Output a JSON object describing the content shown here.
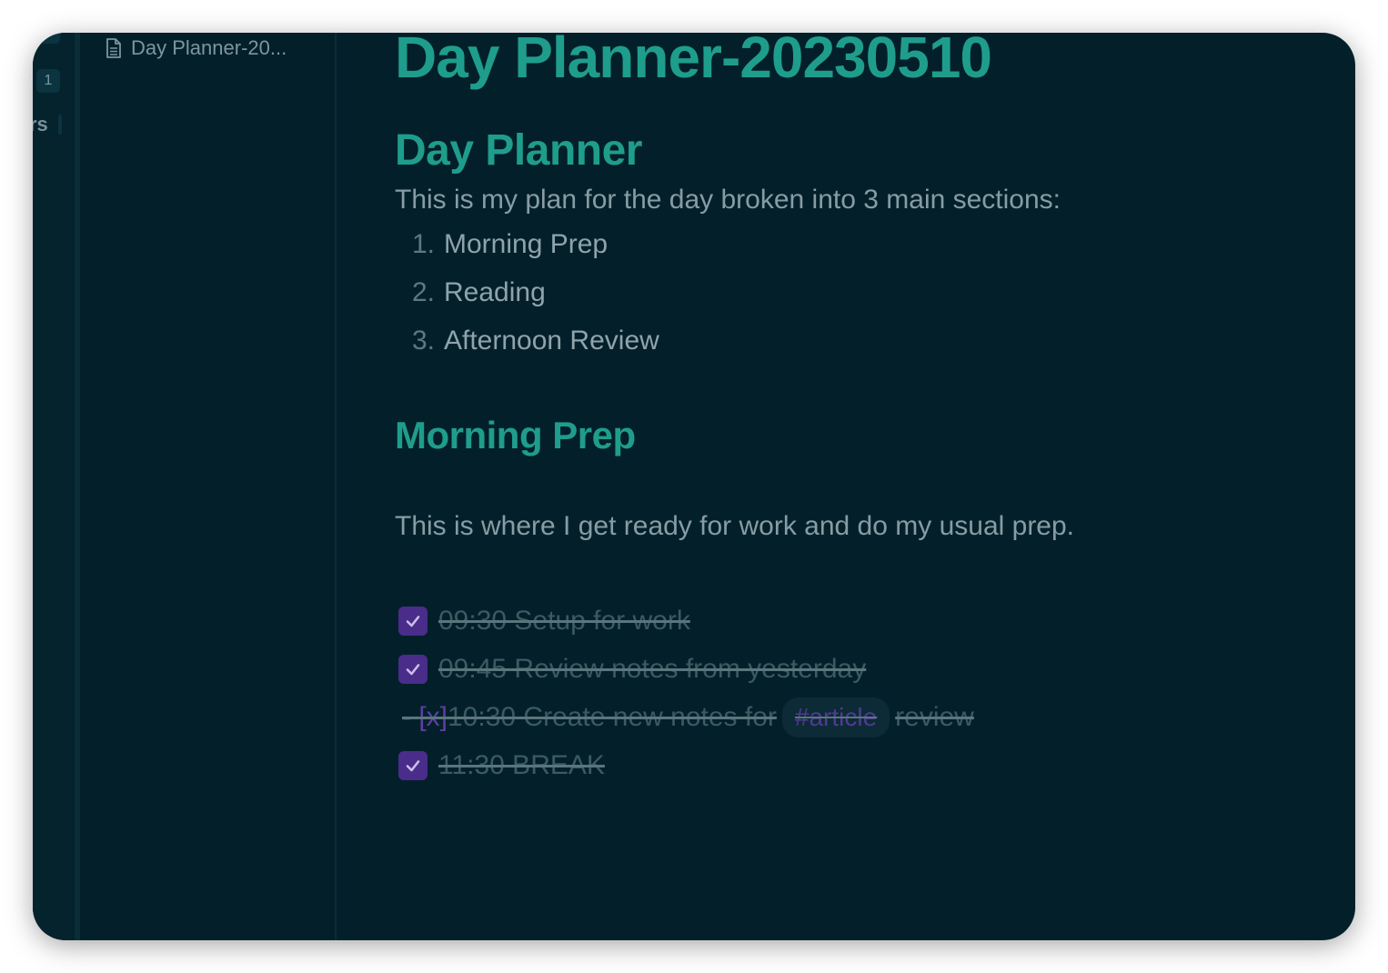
{
  "ribbon": {
    "badge_count": "1",
    "clip_text": "–",
    "partial_label": "rs"
  },
  "explorer": {
    "file_name": "Day Planner-20..."
  },
  "editor": {
    "title": "Day Planner-20230510",
    "section1_heading": "Day Planner",
    "section1_intro": "This is my plan for the day broken into 3 main sections:",
    "list": [
      {
        "num": "1.",
        "text": "Morning Prep"
      },
      {
        "num": "2.",
        "text": "Reading"
      },
      {
        "num": "3.",
        "text": "Afternoon Review"
      }
    ],
    "section2_heading": "Morning Prep",
    "section2_text": "This is where I get ready for work and do my usual prep.",
    "tasks": [
      {
        "text": "09:30 Setup for work",
        "checked": true
      },
      {
        "text": "09:45 Review notes from yesterday",
        "checked": true
      }
    ],
    "raw_task": {
      "dash": "- ",
      "marker": "[x]",
      "text_before": " 10:30 Create new notes for",
      "tag": "#article",
      "text_after": "review"
    },
    "last_task": {
      "text": "11:30 BREAK",
      "checked": true
    }
  },
  "colors": {
    "background": "#03202a",
    "heading": "#1f9d8c",
    "text": "#879ca3",
    "checkbox": "#4a2c8a",
    "tag_text": "#4f3a91"
  }
}
